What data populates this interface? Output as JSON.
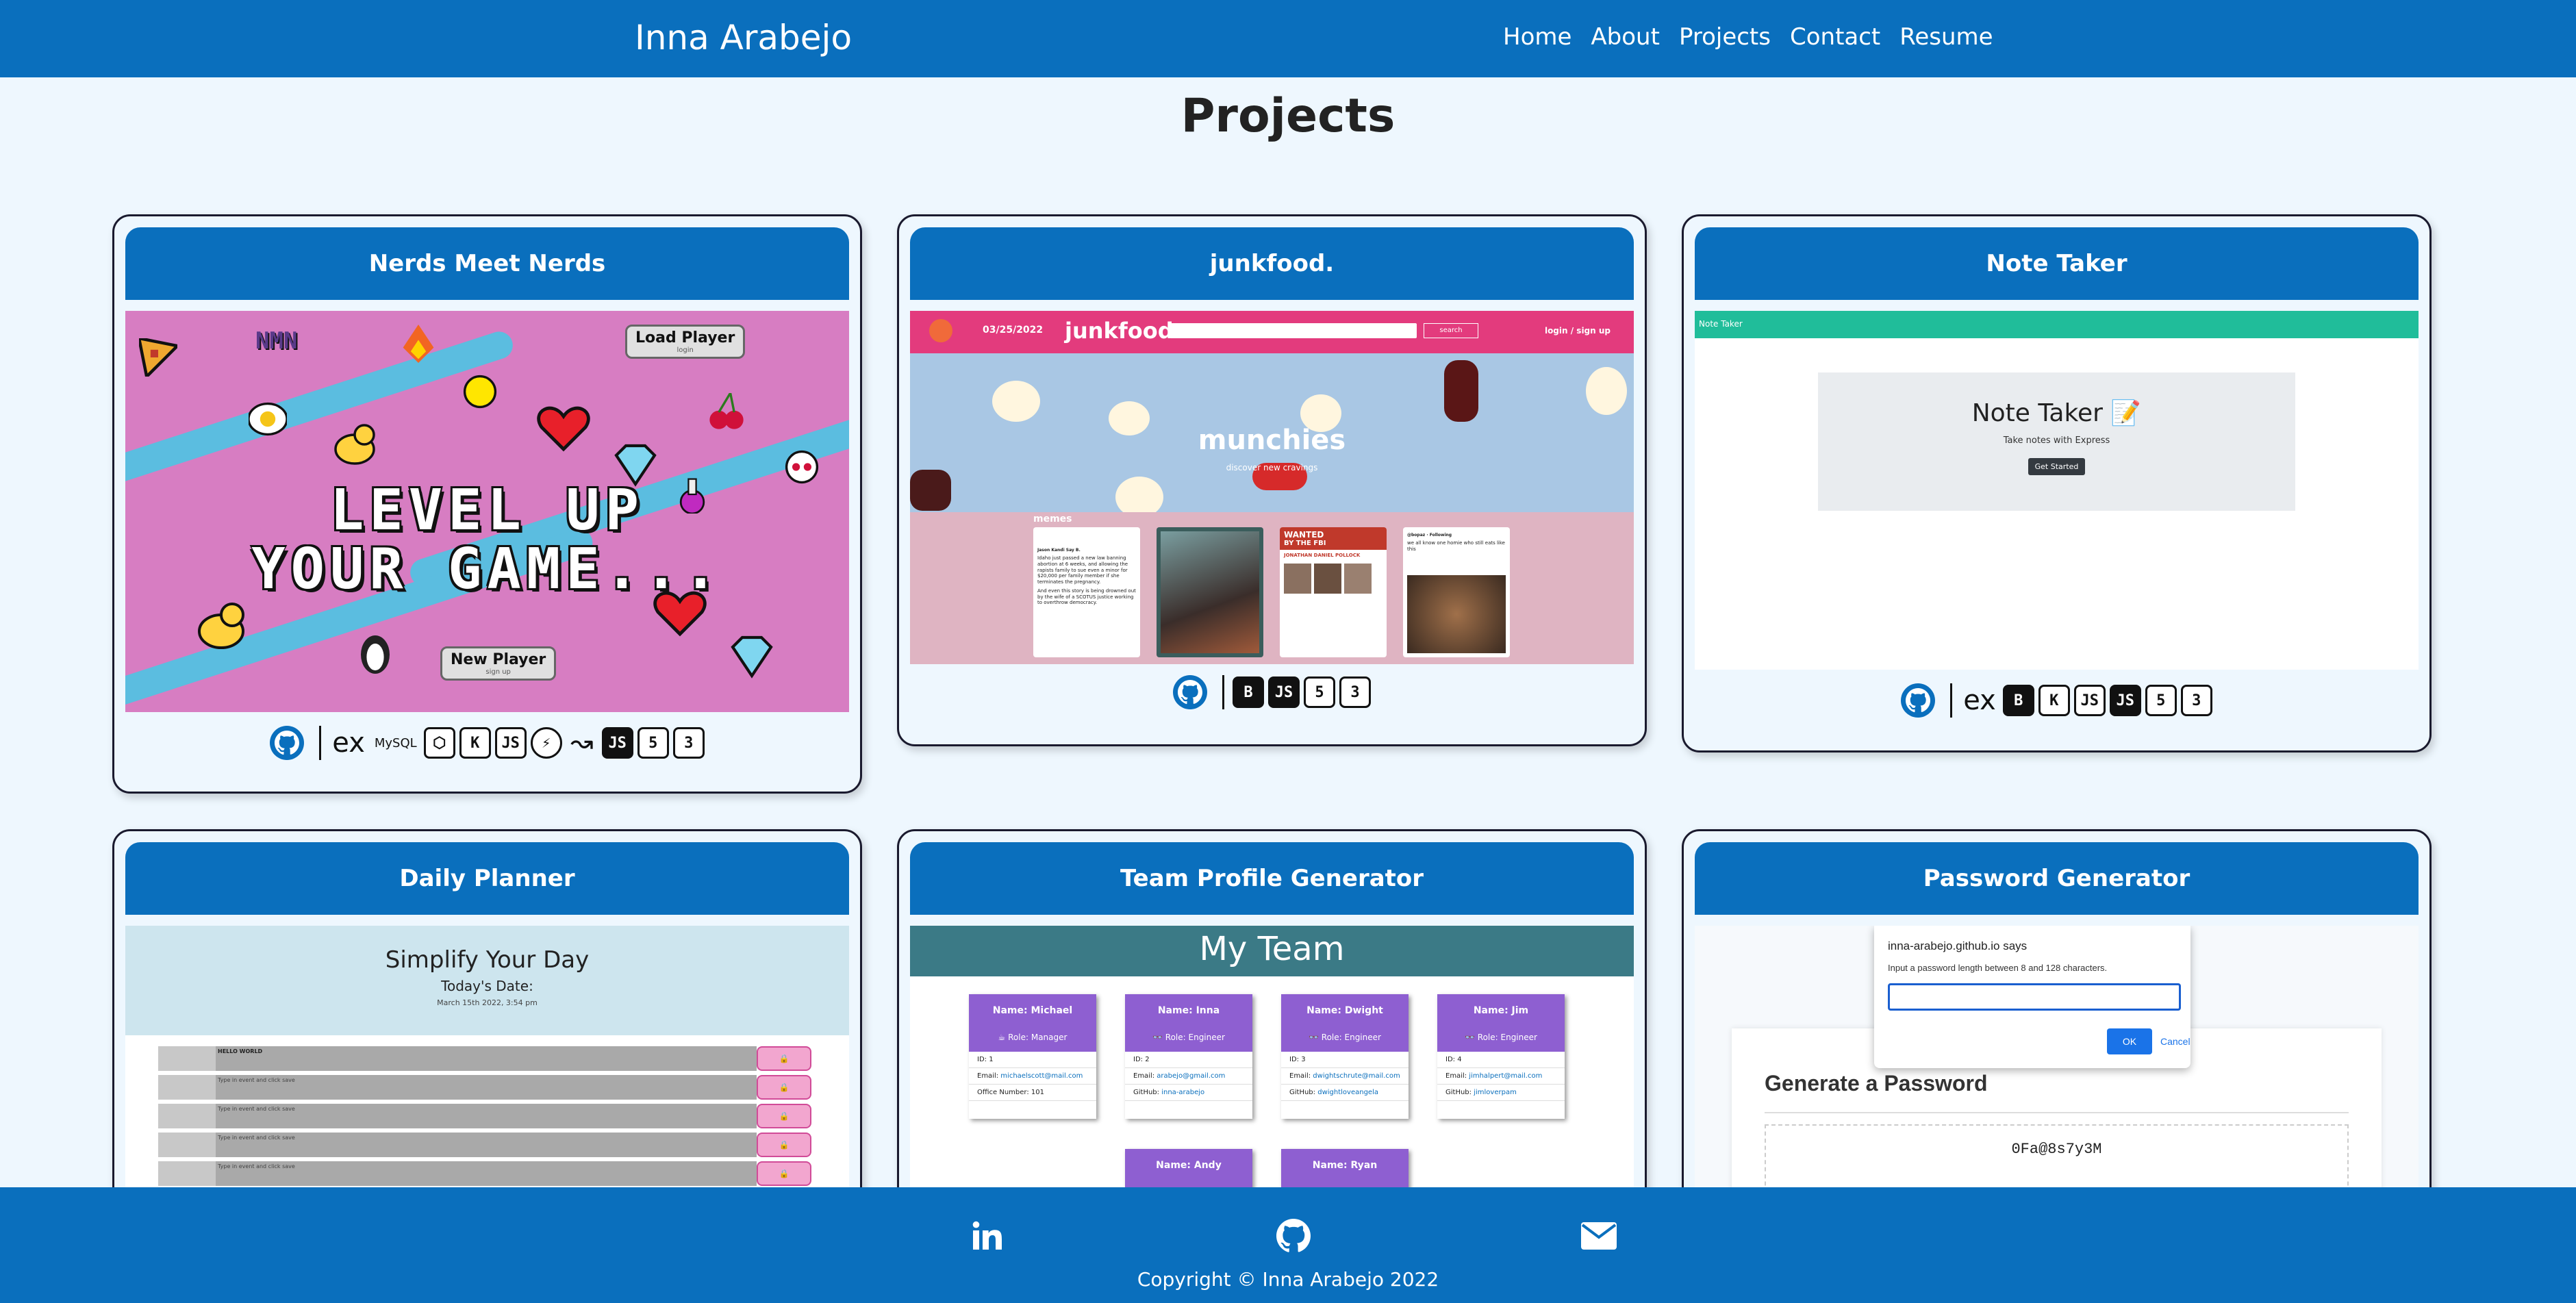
{
  "navbar": {
    "brand": "Inna Arabejo",
    "links": [
      "Home",
      "About",
      "Projects",
      "Contact",
      "Resume"
    ]
  },
  "page": {
    "title": "Projects"
  },
  "projects": [
    {
      "title": "Nerds Meet Nerds",
      "screenshot": {
        "headline_line1": "LEVEL UP",
        "headline_line2": "YOUR GAME...",
        "load_button": "Load Player",
        "load_sub": "login",
        "new_button": "New Player",
        "new_sub": "sign up",
        "logo": "NMN"
      },
      "tech": [
        "github-icon",
        "express-icon",
        "mysql-icon",
        "sequelize-icon",
        "handlebars-icon",
        "nodejs-icon",
        "bcrypt-icon",
        "jawsdb-icon",
        "javascript-icon",
        "html5-icon",
        "css3-icon"
      ]
    },
    {
      "title": "junkfood.",
      "screenshot": {
        "date": "03/25/2022",
        "brand": "junkfood.",
        "search_button": "search",
        "login": "login / sign up",
        "hero_title": "munchies",
        "hero_sub": "discover new cravings",
        "section": "memes",
        "tweet1_author": "Jason Kandi Say B.",
        "tweet1_text": "Idaho just passed a new law banning abortion at 6 weeks, and allowing the rapists family to sue even a minor for $20,000 per family member if she terminates the pregnancy.",
        "tweet1_text2": "And even this story is being drowned out by the wife of a SCOTUS justice working to overthrow democracy.",
        "wanted_title": "WANTED",
        "wanted_sub": "BY THE FBI",
        "wanted_name": "JONATHAN DANIEL POLLOCK",
        "tweet4_author": "@bopaz · Following",
        "tweet4_text": "we all know one homie who still eats like this"
      },
      "tech": [
        "github-icon",
        "bootstrap-icon",
        "javascript-icon",
        "html5-icon",
        "css3-icon"
      ]
    },
    {
      "title": "Note Taker",
      "screenshot": {
        "bar_text": "Note Taker",
        "title": "Note Taker 📝",
        "subtitle": "Take notes with Express",
        "button": "Get Started"
      },
      "tech": [
        "github-icon",
        "express-icon",
        "bootstrap-icon",
        "handlebars-icon",
        "nodejs-icon",
        "javascript-icon",
        "html5-icon",
        "css3-icon"
      ]
    },
    {
      "title": "Daily Planner",
      "screenshot": {
        "title": "Simplify Your Day",
        "date_label": "Today's Date:",
        "date_value": "March 15th 2022, 3:54 pm",
        "first_entry": "HELLO WORLD",
        "placeholder": "Type in event and click save"
      }
    },
    {
      "title": "Team Profile Generator",
      "screenshot": {
        "header": "My Team",
        "members": [
          {
            "name": "Name: Michael",
            "role": "☕ Role: Manager",
            "id": "ID: 1",
            "email": "michaelscott@mail.com",
            "extra_label": "Office Number:",
            "extra_value": "101"
          },
          {
            "name": "Name: Inna",
            "role": "👓 Role: Engineer",
            "id": "ID: 2",
            "email": "arabejo@gmail.com",
            "extra_label": "GitHub:",
            "extra_value": "inna-arabejo"
          },
          {
            "name": "Name: Dwight",
            "role": "👓 Role: Engineer",
            "id": "ID: 3",
            "email": "dwightschrute@mail.com",
            "extra_label": "GitHub:",
            "extra_value": "dwightloveangela"
          },
          {
            "name": "Name: Jim",
            "role": "👓 Role: Engineer",
            "id": "ID: 4",
            "email": "jimhalpert@mail.com",
            "extra_label": "GitHub:",
            "extra_value": "jimloverpam"
          },
          {
            "name": "Name: Andy"
          },
          {
            "name": "Name: Ryan"
          }
        ]
      }
    },
    {
      "title": "Password Generator",
      "screenshot": {
        "dialog_site": "inna-arabejo.github.io says",
        "dialog_msg": "Input a password length between 8 and 128 characters.",
        "dialog_ok": "OK",
        "dialog_cancel": "Cancel",
        "title": "Generate a Password",
        "password": "0Fa@8s7y3M"
      }
    }
  ],
  "footer": {
    "icons": [
      "linkedin-icon",
      "github-icon",
      "email-icon"
    ],
    "copyright": "Copyright © Inna Arabejo 2022"
  },
  "colors": {
    "primary": "#0a6fbd",
    "background": "#eef7fe",
    "card_border": "#1a1a2e"
  }
}
